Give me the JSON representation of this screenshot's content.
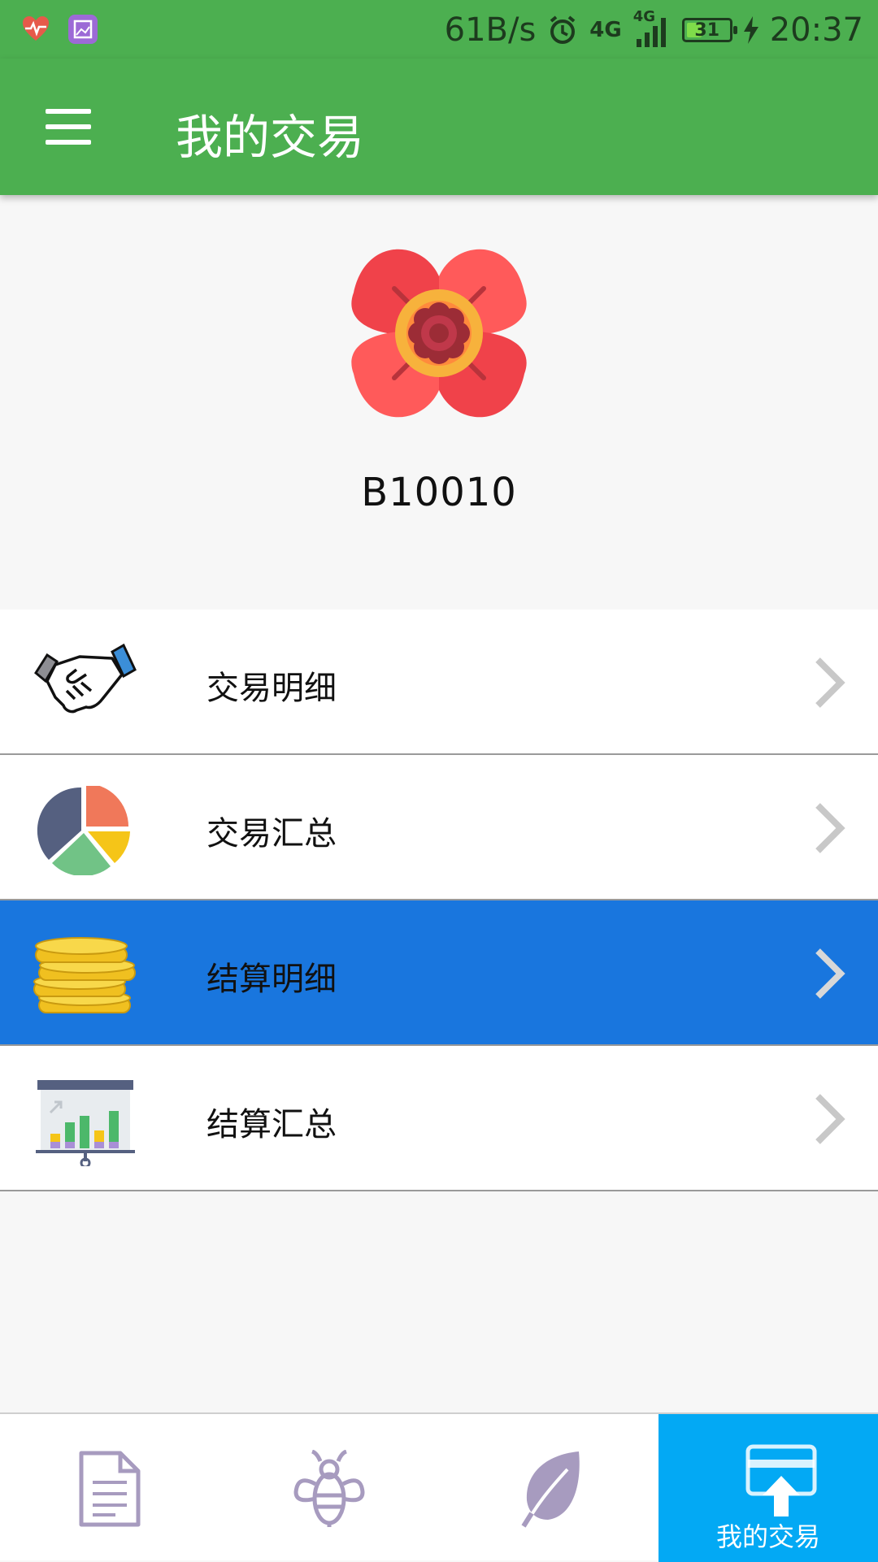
{
  "status_bar": {
    "network_speed": "61B/s",
    "network_type_1": "4G",
    "network_type_2": "4G",
    "battery": "31",
    "time": "20:37"
  },
  "app_bar": {
    "title": "我的交易"
  },
  "profile": {
    "username": "B10010"
  },
  "menu": {
    "items": [
      {
        "label": "交易明细",
        "icon": "handshake-icon"
      },
      {
        "label": "交易汇总",
        "icon": "pie-chart-icon"
      },
      {
        "label": "结算明细",
        "icon": "coins-icon"
      },
      {
        "label": "结算汇总",
        "icon": "presentation-chart-icon"
      }
    ],
    "selected_index": 2
  },
  "bottom_nav": {
    "tabs": [
      {
        "icon": "document-icon",
        "label": ""
      },
      {
        "icon": "bee-icon",
        "label": ""
      },
      {
        "icon": "leaf-icon",
        "label": ""
      },
      {
        "icon": "card-upload-icon",
        "label": "我的交易"
      }
    ],
    "active_index": 3
  },
  "colors": {
    "primary": "#4caf50",
    "selected_row": "#1976de",
    "active_tab": "#03a9f4"
  }
}
